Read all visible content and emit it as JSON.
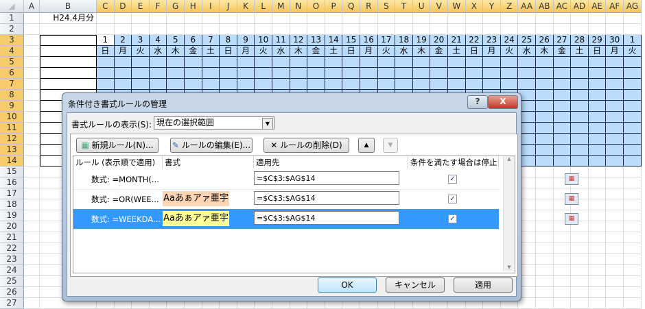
{
  "sheet": {
    "corner": "",
    "col_headers": [
      "A",
      "B",
      "C",
      "D",
      "E",
      "F",
      "G",
      "H",
      "I",
      "J",
      "K",
      "L",
      "M",
      "N",
      "O",
      "P",
      "Q",
      "R",
      "S",
      "T",
      "U",
      "V",
      "W",
      "X",
      "Y",
      "Z",
      "AA",
      "AB",
      "AC",
      "AD",
      "AE",
      "AF",
      "AG"
    ],
    "row_headers": [
      "1",
      "2",
      "3",
      "4",
      "5",
      "6",
      "7",
      "8",
      "9",
      "10",
      "11",
      "12",
      "13",
      "14",
      "15",
      "16",
      "17",
      "18",
      "19",
      "20",
      "21",
      "22",
      "23",
      "24",
      "25",
      "26",
      "27"
    ],
    "b1": "H24.4月分",
    "days": [
      "1",
      "2",
      "3",
      "4",
      "5",
      "6",
      "7",
      "8",
      "9",
      "10",
      "11",
      "12",
      "13",
      "14",
      "15",
      "16",
      "17",
      "18",
      "19",
      "20",
      "21",
      "22",
      "23",
      "24",
      "25",
      "26",
      "27",
      "28",
      "29",
      "30",
      "1"
    ],
    "weekdays": [
      "日",
      "月",
      "火",
      "水",
      "木",
      "金",
      "土",
      "日",
      "月",
      "火",
      "水",
      "木",
      "金",
      "土",
      "日",
      "月",
      "火",
      "水",
      "木",
      "金",
      "土",
      "日",
      "月",
      "火",
      "水",
      "木",
      "金",
      "土",
      "日",
      "月",
      "火"
    ],
    "fill_color": "#bcdcfc"
  },
  "dialog": {
    "title": "条件付き書式ルールの管理",
    "help": "?",
    "close": "X",
    "show_label": "書式ルールの表示(S):",
    "show_value": "現在の選択範囲",
    "new_rule": "新規ルール(N)...",
    "edit_rule": "ルールの編集(E)...",
    "delete_rule": "ルールの削除(D)",
    "columns": [
      "ルール (表示順で適用)",
      "書式",
      "適用先",
      "条件を満たす場合は停止"
    ],
    "rules": [
      {
        "rule": "数式: =MONTH(...",
        "format": "",
        "applies": "=$C$3:$AG$14",
        "stop": true,
        "color": ""
      },
      {
        "rule": "数式: =OR(WEE...",
        "format": "Aaあぁアァ亜宇",
        "applies": "=$C$3:$AG$14",
        "stop": true,
        "color": "#fcd5b4"
      },
      {
        "rule": "数式: =WEEKDA...",
        "format": "Aaあぁアァ亜宇",
        "applies": "=$C$3:$AG$14",
        "stop": true,
        "color": "#ffff99"
      }
    ],
    "ok": "OK",
    "cancel": "キャンセル",
    "apply": "適用"
  }
}
